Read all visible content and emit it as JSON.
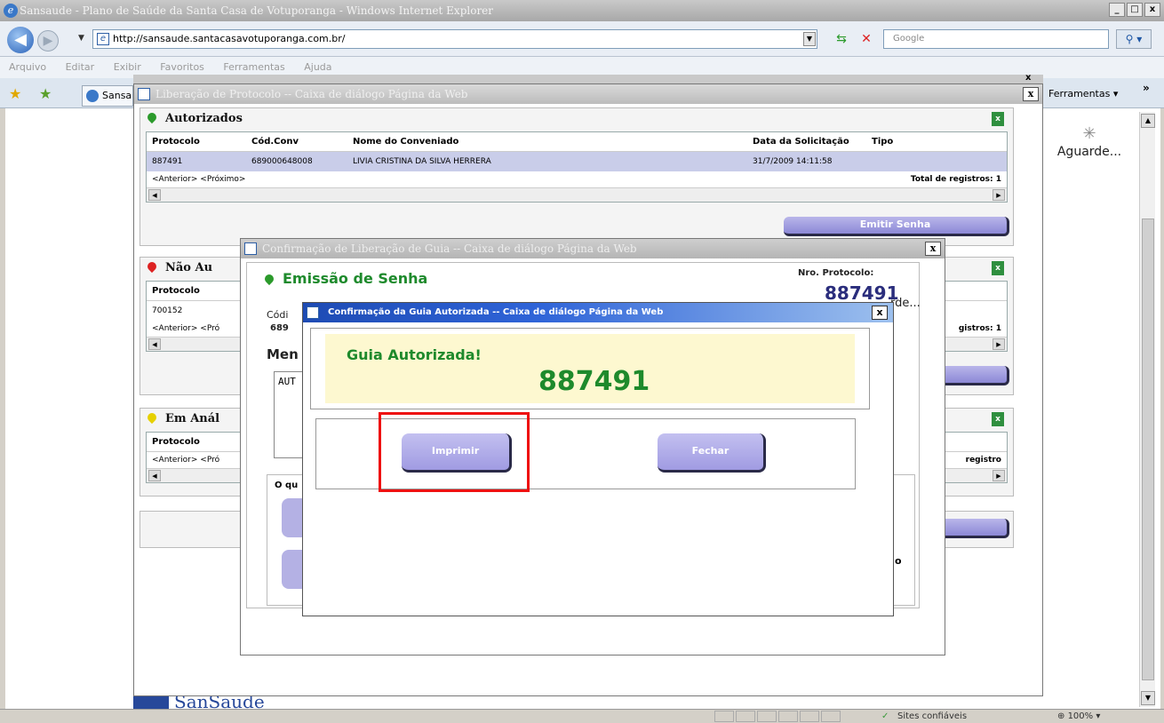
{
  "browser": {
    "title": "Sansaude - Plano de Saúde da Santa Casa de Votuporanga - Windows Internet Explorer",
    "url": "http://sansaude.santacasavotuporanga.com.br/",
    "search_placeholder": "Google",
    "menu": [
      "Arquivo",
      "Editar",
      "Exibir",
      "Favoritos",
      "Ferramentas",
      "Ajuda"
    ],
    "tab_label": "Sansaude",
    "tools_label": "Ferramentas",
    "status_zone": "Sites confiáveis",
    "zoom": "100%",
    "aguarde": "Aguarde..."
  },
  "dialog_liberacao": {
    "title": "Liberação de Protocolo -- Caixa de diálogo Página da Web",
    "autorizados": {
      "heading": "Autorizados",
      "columns": [
        "Protocolo",
        "Cód.Conv",
        "Nome do Conveniado",
        "Data da Solicitação",
        "Tipo"
      ],
      "rows": [
        {
          "protocolo": "887491",
          "cod_conv": "689000648008",
          "nome": "LIVIA CRISTINA DA SILVA HERRERA",
          "data": "31/7/2009 14:11:58",
          "tipo": ""
        }
      ],
      "pager": "<Anterior> <Próximo>",
      "total": "Total de registros: 1",
      "emitir_button": "Emitir Senha"
    },
    "nao_autorizados": {
      "heading": "Não Au",
      "column": "Protocolo",
      "row_protocolo": "700152",
      "pager": "<Anterior> <Pró",
      "total": "gistros: 1"
    },
    "em_analise": {
      "heading": "Em Anál",
      "column": "Protocolo",
      "pager": "<Anterior> <Pró",
      "total": "registro"
    }
  },
  "dialog_confirmacao_liberacao": {
    "title": "Confirmação de Liberação de Guia -- Caixa de diálogo Página da Web",
    "emissao_title": "Emissão de Senha",
    "nro_protocolo_label": "Nro. Protocolo:",
    "nro_protocolo_value": "887491",
    "aguarde": "rde...",
    "codigo_label": "Códi",
    "codigo_value": "689",
    "mensagem_label": "Men",
    "mensagem_text": "AUT",
    "oq_label": "O qu",
    "side_text": "o"
  },
  "dialog_guia_autorizada": {
    "title": "Confirmação da Guia Autorizada -- Caixa de diálogo Página da Web",
    "message": "Guia Autorizada!",
    "number": "887491",
    "print_button": "Imprimir",
    "close_button": "Fechar"
  },
  "footer": {
    "logo_text": "SanSaude"
  }
}
